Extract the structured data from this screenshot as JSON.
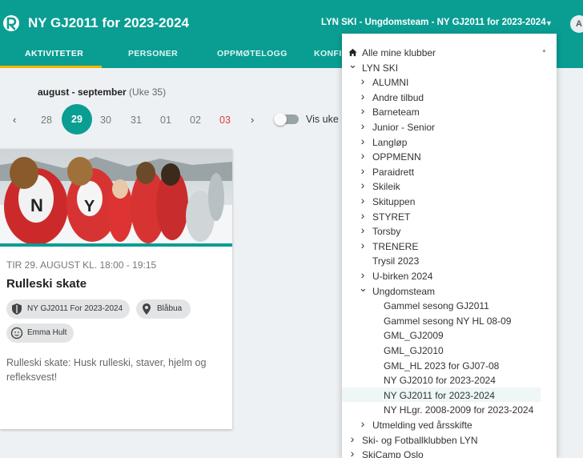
{
  "header": {
    "app_title": "NY GJ2011 for 2023-2024",
    "club_selector": "LYN SKI - Ungdomsteam - NY GJ2011 for 2023-2024",
    "avatar_initial": "A",
    "colors": {
      "primary": "#0a9e93",
      "tab_indicator": "#f5b400",
      "weekend": "#e03a3a"
    }
  },
  "tabs": [
    {
      "label": "AKTIVITETER",
      "active": true
    },
    {
      "label": "PERSONER"
    },
    {
      "label": "OPPMØTELOGG"
    },
    {
      "label": "KONFIG"
    }
  ],
  "week": {
    "title": "august - september",
    "uke": "(Uke 35)",
    "days": [
      "28",
      "29",
      "30",
      "31",
      "01",
      "02",
      "03"
    ],
    "selected_day": "29",
    "toggle_label": "Vis uke"
  },
  "activity": {
    "time": "TIR 29. AUGUST KL. 18:00 - 19:15",
    "title": "Rulleski skate",
    "group_chip": "NY GJ2011 For 2023-2024",
    "location_chip": "Blåbua",
    "person_chip": "Emma Hult",
    "description": "Rulleski skate: Husk rulleski, staver, hjelm og refleksvest!"
  },
  "dropdown": {
    "items": [
      {
        "label": "Alle mine klubber",
        "icon": "home-icon"
      },
      {
        "label": "LYN SKI",
        "icon": "chevron-down-icon"
      },
      {
        "label": "ALUMNI",
        "icon": "chevron-right-icon"
      },
      {
        "label": "Andre tilbud",
        "icon": "chevron-right-icon"
      },
      {
        "label": "Barneteam",
        "icon": "chevron-right-icon"
      },
      {
        "label": "Junior - Senior",
        "icon": "chevron-right-icon"
      },
      {
        "label": "Langløp",
        "icon": "chevron-right-icon"
      },
      {
        "label": "OPPMENN",
        "icon": "chevron-right-icon"
      },
      {
        "label": "Paraidrett",
        "icon": "chevron-right-icon"
      },
      {
        "label": "Skileik",
        "icon": "chevron-right-icon"
      },
      {
        "label": "Skituppen",
        "icon": "chevron-right-icon"
      },
      {
        "label": "STYRET",
        "icon": "chevron-right-icon"
      },
      {
        "label": "Torsby",
        "icon": "chevron-right-icon"
      },
      {
        "label": "TRENERE",
        "icon": "chevron-right-icon"
      },
      {
        "label": "Trysil 2023"
      },
      {
        "label": "U-birken 2024",
        "icon": "chevron-right-icon"
      },
      {
        "label": "Ungdomsteam",
        "icon": "chevron-down-icon"
      },
      {
        "label": "Gammel sesong GJ2011"
      },
      {
        "label": "Gammel sesong NY HL 08-09"
      },
      {
        "label": "GML_GJ2009"
      },
      {
        "label": "GML_GJ2010"
      },
      {
        "label": "GML_HL 2023 for GJ07-08"
      },
      {
        "label": "NY GJ2010 for 2023-2024"
      },
      {
        "label": "NY GJ2011 for 2023-2024",
        "selected": true
      },
      {
        "label": "NY HLgr. 2008-2009 for 2023-2024"
      },
      {
        "label": "Utmelding ved årsskifte",
        "icon": "chevron-right-icon"
      },
      {
        "label": "Ski- og Fotballklubben LYN",
        "icon": "chevron-right-icon"
      },
      {
        "label": "SkiCamp Oslo",
        "icon": "chevron-right-icon"
      }
    ]
  }
}
